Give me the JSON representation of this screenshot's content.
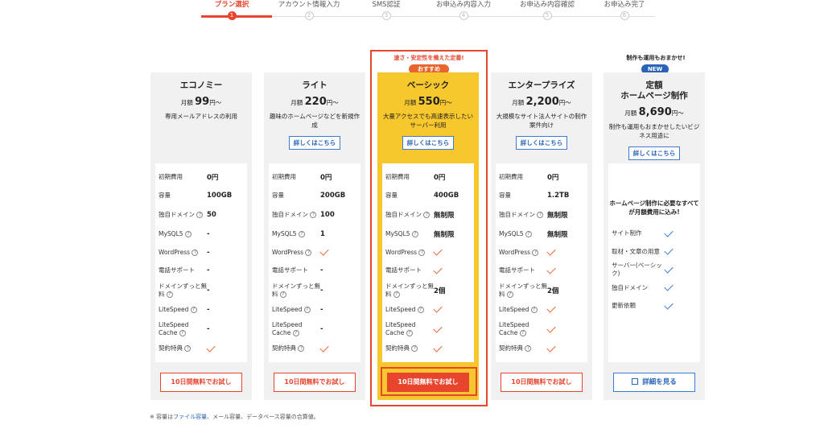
{
  "stepper": {
    "steps": [
      {
        "label": "プラン選択",
        "num": "1"
      },
      {
        "label": "アカウント情報入力",
        "num": "2"
      },
      {
        "label": "SMS認証",
        "num": "3"
      },
      {
        "label": "お申込み内容入力",
        "num": "4"
      },
      {
        "label": "お申込み内容確認",
        "num": "5"
      },
      {
        "label": "お申込み完了",
        "num": "6"
      }
    ],
    "active_index": 0
  },
  "tags": {
    "basic_top": "速さ・安定性を備えた定番!",
    "recommended": "おすすめ",
    "hp_top": "制作も運用もおまかせ!",
    "new": "NEW"
  },
  "labels": {
    "initial_fee": "初期費用",
    "capacity": "容量",
    "domain": "独自ドメイン",
    "mysql": "MySQL5",
    "wordpress": "WordPress",
    "phone": "電話サポート",
    "free_domain": "ドメインずっと無料",
    "litespeed": "LiteSpeed",
    "litespeed_cache": "LiteSpeed Cache",
    "benefit": "契約特典",
    "help": "?",
    "detail": "詳しくはこちら",
    "trial": "10日間無料でお試し",
    "view": "詳細を見る",
    "price_prefix": "月額",
    "price_suffix": "円〜"
  },
  "plans": [
    {
      "name": "エコノミー",
      "price": "99",
      "desc": "専用メールアドレスの利用",
      "initial": "0円",
      "capacity": "100GB",
      "domain": "50",
      "mysql": "-",
      "wordpress": "-",
      "phone": "-",
      "free_domain": "-",
      "litespeed": "-",
      "litespeed_cache": "-"
    },
    {
      "name": "ライト",
      "price": "220",
      "desc": "趣味のホームページなどを新規作成",
      "initial": "0円",
      "capacity": "200GB",
      "domain": "100",
      "mysql": "1",
      "wordpress": "",
      "phone": "-",
      "free_domain": "-",
      "litespeed": "-",
      "litespeed_cache": "-"
    },
    {
      "name": "ベーシック",
      "price": "550",
      "desc": "大量アクセスでも高速表示したいサーバー利用",
      "initial": "0円",
      "capacity": "400GB",
      "domain": "無制限",
      "mysql": "無制限",
      "wordpress": "",
      "phone": "",
      "free_domain": "2個",
      "litespeed": "",
      "litespeed_cache": ""
    },
    {
      "name": "エンタープライズ",
      "price": "2,200",
      "desc": "大規模なサイト法人サイトの制作案件向け",
      "initial": "0円",
      "capacity": "1.2TB",
      "domain": "無制限",
      "mysql": "無制限",
      "wordpress": "",
      "phone": "",
      "free_domain": "2個",
      "litespeed": "",
      "litespeed_cache": ""
    }
  ],
  "hp_plan": {
    "name_line1": "定額",
    "name_line2": "ホームページ制作",
    "price": "8,690",
    "desc": "制作も運用もおまかせしたいビジネス用途に",
    "intro": "ホームページ制作に必要なすべてが月額費用に込み!",
    "items": [
      "サイト制作",
      "取材・文章の用意",
      "サーバー(ベーシック)",
      "独自ドメイン",
      "更新依頼"
    ]
  },
  "note": {
    "prefix": "※ 容量は",
    "link": "ファイル容量",
    "suffix": "、メール容量、データベース容量の合算値。"
  },
  "colors": {
    "accent": "#e8452e",
    "basic_bg": "#f7c72e",
    "link": "#2a64b8"
  }
}
